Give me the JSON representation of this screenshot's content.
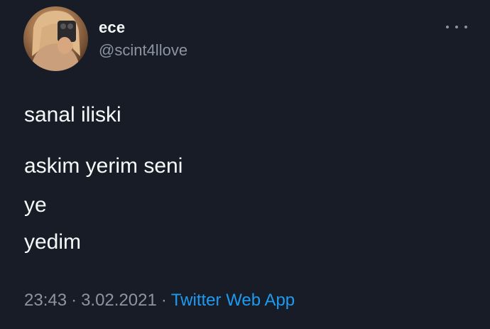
{
  "tweet": {
    "author": {
      "name": "ece",
      "handle": "@scint4llove",
      "avatar_icon": "profile-photo"
    },
    "more_icon": "more-horizontal-icon",
    "lines": [
      "sanal iliski",
      "askim yerim seni",
      "ye",
      "yedim"
    ],
    "meta": {
      "time": "23:43",
      "separator": "·",
      "date": "3.02.2021",
      "source": "Twitter Web App"
    }
  },
  "colors": {
    "background": "#171c27",
    "text": "#f7f8fa",
    "secondary": "#8b95a1",
    "link": "#1d9bf0"
  }
}
